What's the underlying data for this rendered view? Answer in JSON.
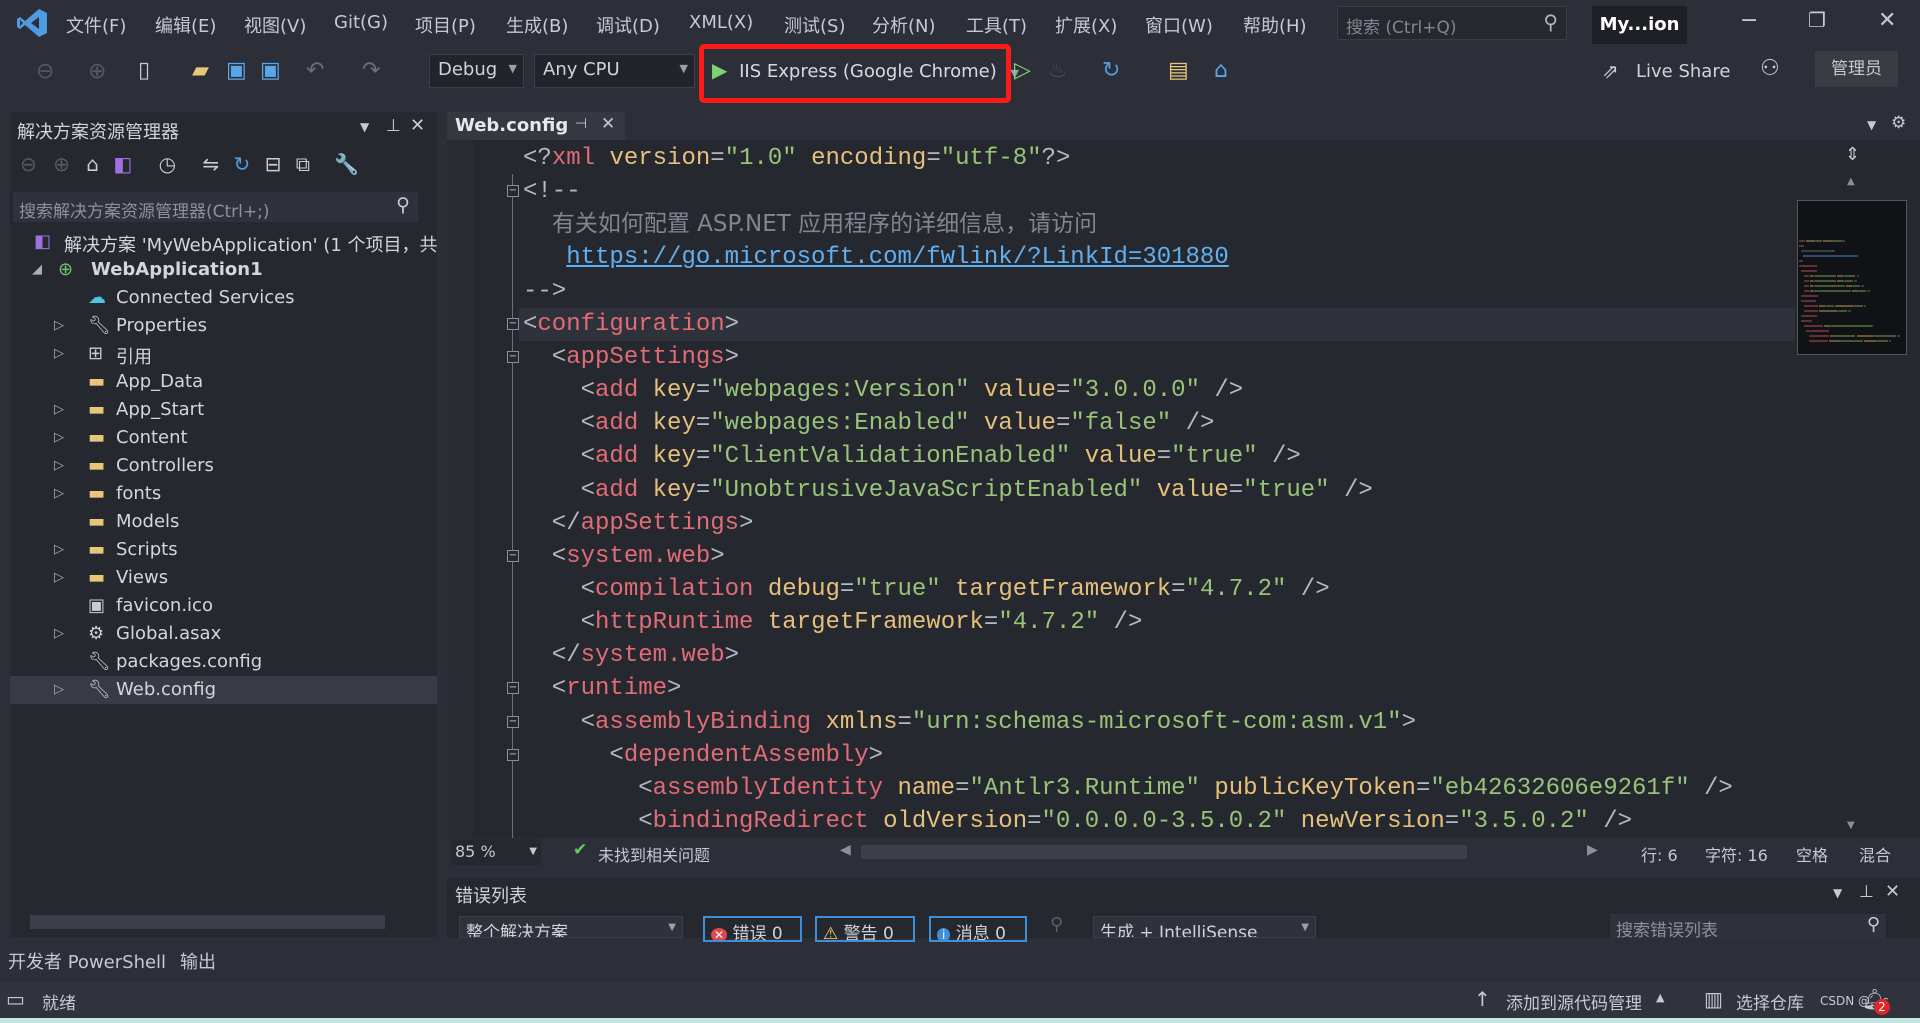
{
  "titlebar": {
    "menu": [
      "文件(F)",
      "编辑(E)",
      "视图(V)",
      "Git(G)",
      "项目(P)",
      "生成(B)",
      "调试(D)",
      "XML(X)",
      "测试(S)",
      "分析(N)",
      "工具(T)",
      "扩展(X)",
      "窗口(W)",
      "帮助(H)"
    ],
    "search_placeholder": "搜索 (Ctrl+Q)",
    "solution_badge": "My...ion"
  },
  "toolbar": {
    "config": "Debug",
    "platform": "Any CPU",
    "run_target": "IIS Express (Google Chrome)",
    "live_share": "Live Share",
    "admin": "管理员",
    "highlight_color": "#ff1a1a"
  },
  "solution_explorer": {
    "title": "解决方案资源管理器",
    "search_placeholder": "搜索解决方案资源管理器(Ctrl+;)",
    "items": [
      {
        "label": "解决方案 'MyWebApplication' (1 个项目，共",
        "icon": "solution-icon",
        "level": 0,
        "expander": ""
      },
      {
        "label": "WebApplication1",
        "icon": "web-project-icon",
        "level": 1,
        "expander": "◢",
        "bold": true
      },
      {
        "label": "Connected Services",
        "icon": "connected-services-icon",
        "level": 2,
        "expander": ""
      },
      {
        "label": "Properties",
        "icon": "wrench-icon",
        "level": 2,
        "expander": "▷"
      },
      {
        "label": "引用",
        "icon": "references-icon",
        "level": 2,
        "expander": "▷"
      },
      {
        "label": "App_Data",
        "icon": "folder-icon",
        "level": 2,
        "expander": ""
      },
      {
        "label": "App_Start",
        "icon": "folder-icon",
        "level": 2,
        "expander": "▷"
      },
      {
        "label": "Content",
        "icon": "folder-icon",
        "level": 2,
        "expander": "▷"
      },
      {
        "label": "Controllers",
        "icon": "folder-icon",
        "level": 2,
        "expander": "▷"
      },
      {
        "label": "fonts",
        "icon": "folder-icon",
        "level": 2,
        "expander": "▷"
      },
      {
        "label": "Models",
        "icon": "folder-icon",
        "level": 2,
        "expander": ""
      },
      {
        "label": "Scripts",
        "icon": "folder-icon",
        "level": 2,
        "expander": "▷"
      },
      {
        "label": "Views",
        "icon": "folder-icon",
        "level": 2,
        "expander": "▷"
      },
      {
        "label": "favicon.ico",
        "icon": "image-file-icon",
        "level": 2,
        "expander": ""
      },
      {
        "label": "Global.asax",
        "icon": "gear-file-icon",
        "level": 2,
        "expander": "▷"
      },
      {
        "label": "packages.config",
        "icon": "config-file-icon",
        "level": 2,
        "expander": ""
      },
      {
        "label": "Web.config",
        "icon": "config-file-icon",
        "level": 2,
        "expander": "▷",
        "selected": true
      }
    ]
  },
  "editor": {
    "tab": "Web.config",
    "current_line_index": 5,
    "lines": [
      {
        "fold": false,
        "tokens": [
          [
            "p",
            "<?"
          ],
          [
            "tag",
            "xml"
          ],
          [
            "p",
            " "
          ],
          [
            "attr",
            "version"
          ],
          [
            "p",
            "="
          ],
          [
            "val",
            "\"1.0\""
          ],
          [
            "p",
            " "
          ],
          [
            "attr",
            "encoding"
          ],
          [
            "p",
            "="
          ],
          [
            "val",
            "\"utf-8\""
          ],
          [
            "p",
            "?>"
          ]
        ]
      },
      {
        "fold": true,
        "tokens": [
          [
            "p",
            "<!--"
          ]
        ]
      },
      {
        "fold": false,
        "tokens": [
          [
            "p",
            "  "
          ],
          [
            "cm",
            "有关如何配置 ASP.NET 应用程序的详细信息，请访问"
          ]
        ]
      },
      {
        "fold": false,
        "tokens": [
          [
            "p",
            "   "
          ],
          [
            "link",
            "https://go.microsoft.com/fwlink/?LinkId=301880"
          ]
        ]
      },
      {
        "fold": false,
        "tokens": [
          [
            "p",
            "-->"
          ]
        ]
      },
      {
        "fold": true,
        "tokens": [
          [
            "p",
            "<"
          ],
          [
            "tag",
            "configuration"
          ],
          [
            "p",
            ">"
          ]
        ]
      },
      {
        "fold": true,
        "tokens": [
          [
            "p",
            "  <"
          ],
          [
            "tag",
            "appSettings"
          ],
          [
            "p",
            ">"
          ]
        ]
      },
      {
        "fold": false,
        "tokens": [
          [
            "p",
            "    <"
          ],
          [
            "tag",
            "add"
          ],
          [
            "p",
            " "
          ],
          [
            "attr",
            "key"
          ],
          [
            "p",
            "="
          ],
          [
            "val",
            "\"webpages:Version\""
          ],
          [
            "p",
            " "
          ],
          [
            "attr",
            "value"
          ],
          [
            "p",
            "="
          ],
          [
            "val",
            "\"3.0.0.0\""
          ],
          [
            "p",
            " />"
          ]
        ]
      },
      {
        "fold": false,
        "tokens": [
          [
            "p",
            "    <"
          ],
          [
            "tag",
            "add"
          ],
          [
            "p",
            " "
          ],
          [
            "attr",
            "key"
          ],
          [
            "p",
            "="
          ],
          [
            "val",
            "\"webpages:Enabled\""
          ],
          [
            "p",
            " "
          ],
          [
            "attr",
            "value"
          ],
          [
            "p",
            "="
          ],
          [
            "val",
            "\"false\""
          ],
          [
            "p",
            " />"
          ]
        ]
      },
      {
        "fold": false,
        "tokens": [
          [
            "p",
            "    <"
          ],
          [
            "tag",
            "add"
          ],
          [
            "p",
            " "
          ],
          [
            "attr",
            "key"
          ],
          [
            "p",
            "="
          ],
          [
            "val",
            "\"ClientValidationEnabled\""
          ],
          [
            "p",
            " "
          ],
          [
            "attr",
            "value"
          ],
          [
            "p",
            "="
          ],
          [
            "val",
            "\"true\""
          ],
          [
            "p",
            " />"
          ]
        ]
      },
      {
        "fold": false,
        "tokens": [
          [
            "p",
            "    <"
          ],
          [
            "tag",
            "add"
          ],
          [
            "p",
            " "
          ],
          [
            "attr",
            "key"
          ],
          [
            "p",
            "="
          ],
          [
            "val",
            "\"UnobtrusiveJavaScriptEnabled\""
          ],
          [
            "p",
            " "
          ],
          [
            "attr",
            "value"
          ],
          [
            "p",
            "="
          ],
          [
            "val",
            "\"true\""
          ],
          [
            "p",
            " />"
          ]
        ]
      },
      {
        "fold": false,
        "tokens": [
          [
            "p",
            "  </"
          ],
          [
            "tag",
            "appSettings"
          ],
          [
            "p",
            ">"
          ]
        ]
      },
      {
        "fold": true,
        "tokens": [
          [
            "p",
            "  <"
          ],
          [
            "tag",
            "system.web"
          ],
          [
            "p",
            ">"
          ]
        ]
      },
      {
        "fold": false,
        "tokens": [
          [
            "p",
            "    <"
          ],
          [
            "tag",
            "compilation"
          ],
          [
            "p",
            " "
          ],
          [
            "attr",
            "debug"
          ],
          [
            "p",
            "="
          ],
          [
            "val",
            "\"true\""
          ],
          [
            "p",
            " "
          ],
          [
            "attr",
            "targetFramework"
          ],
          [
            "p",
            "="
          ],
          [
            "val",
            "\"4.7.2\""
          ],
          [
            "p",
            " />"
          ]
        ]
      },
      {
        "fold": false,
        "tokens": [
          [
            "p",
            "    <"
          ],
          [
            "tag",
            "httpRuntime"
          ],
          [
            "p",
            " "
          ],
          [
            "attr",
            "targetFramework"
          ],
          [
            "p",
            "="
          ],
          [
            "val",
            "\"4.7.2\""
          ],
          [
            "p",
            " />"
          ]
        ]
      },
      {
        "fold": false,
        "tokens": [
          [
            "p",
            "  </"
          ],
          [
            "tag",
            "system.web"
          ],
          [
            "p",
            ">"
          ]
        ]
      },
      {
        "fold": true,
        "tokens": [
          [
            "p",
            "  <"
          ],
          [
            "tag",
            "runtime"
          ],
          [
            "p",
            ">"
          ]
        ]
      },
      {
        "fold": true,
        "tokens": [
          [
            "p",
            "    <"
          ],
          [
            "tag",
            "assemblyBinding"
          ],
          [
            "p",
            " "
          ],
          [
            "attr",
            "xmlns"
          ],
          [
            "p",
            "="
          ],
          [
            "val",
            "\"urn:schemas-microsoft-com:asm.v1\""
          ],
          [
            "p",
            ">"
          ]
        ]
      },
      {
        "fold": true,
        "tokens": [
          [
            "p",
            "      <"
          ],
          [
            "tag",
            "dependentAssembly"
          ],
          [
            "p",
            ">"
          ]
        ]
      },
      {
        "fold": false,
        "tokens": [
          [
            "p",
            "        <"
          ],
          [
            "tag",
            "assemblyIdentity"
          ],
          [
            "p",
            " "
          ],
          [
            "attr",
            "name"
          ],
          [
            "p",
            "="
          ],
          [
            "val",
            "\"Antlr3.Runtime\""
          ],
          [
            "p",
            " "
          ],
          [
            "attr",
            "publicKeyToken"
          ],
          [
            "p",
            "="
          ],
          [
            "val",
            "\"eb42632606e9261f\""
          ],
          [
            "p",
            " />"
          ]
        ]
      },
      {
        "fold": false,
        "tokens": [
          [
            "p",
            "        <"
          ],
          [
            "tag",
            "bindingRedirect"
          ],
          [
            "p",
            " "
          ],
          [
            "attr",
            "oldVersion"
          ],
          [
            "p",
            "="
          ],
          [
            "val",
            "\"0.0.0.0-3.5.0.2\""
          ],
          [
            "p",
            " "
          ],
          [
            "attr",
            "newVersion"
          ],
          [
            "p",
            "="
          ],
          [
            "val",
            "\"3.5.0.2\""
          ],
          [
            "p",
            " />"
          ]
        ]
      }
    ],
    "status": {
      "zoom": "85 %",
      "issues": "未找到相关问题",
      "line": "行: 6",
      "char": "字符: 16",
      "spaces": "空格",
      "line_endings": "混合"
    }
  },
  "error_list": {
    "title": "错误列表",
    "scope": "整个解决方案",
    "errors": "错误 0",
    "warnings": "警告 0",
    "messages": "消息 0",
    "source": "生成 + IntelliSense",
    "search_placeholder": "搜索错误列表"
  },
  "bottom_tabs": [
    "开发者 PowerShell",
    "输出"
  ],
  "statusbar": {
    "ready": "就绪",
    "add_source_control": "添加到源代码管理",
    "select_repo": "选择仓库",
    "notifications": "2",
    "watermark": "CSDN @…c"
  }
}
